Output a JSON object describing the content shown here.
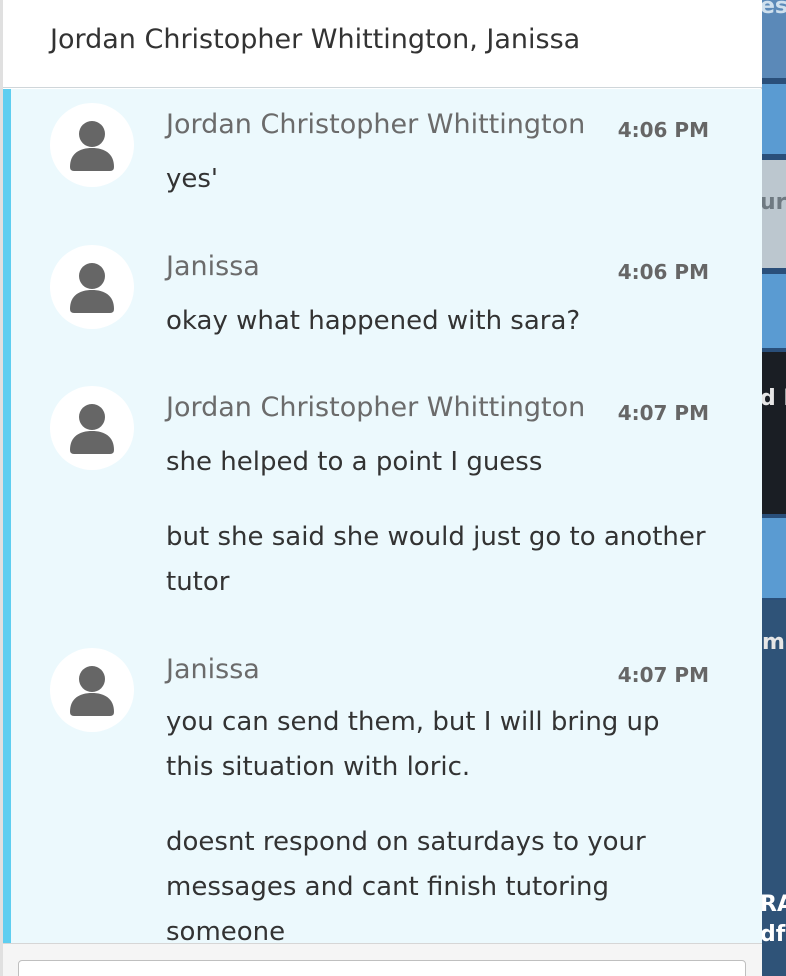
{
  "background": {
    "fragments": [
      "es",
      "ur",
      "d I",
      "m",
      "RA",
      "df"
    ]
  },
  "header": {
    "title": "Jordan Christopher Whittington, Janissa"
  },
  "messages": [
    {
      "sender": "Jordan Christopher Whittington",
      "time": "4:06 PM",
      "paragraphs": [
        "yes'"
      ]
    },
    {
      "sender": "Janissa",
      "time": "4:06 PM",
      "paragraphs": [
        "okay what happened with sara?"
      ]
    },
    {
      "sender": "Jordan Christopher Whittington",
      "time": "4:07 PM",
      "paragraphs": [
        "she helped to a point I guess",
        "but she said she would just go to another tutor"
      ]
    },
    {
      "sender": "Janissa",
      "time": "4:07 PM",
      "paragraphs": [
        "you can send them, but I will bring up this situation with loric.",
        "doesnt respond on saturdays to your messages and cant finish tutoring someone"
      ]
    }
  ],
  "colors": {
    "accent": "#5ecef0",
    "conversation_bg": "#ecf9fd",
    "avatar_icon": "#666666"
  },
  "icons": {
    "avatar": "user-silhouette-icon"
  }
}
